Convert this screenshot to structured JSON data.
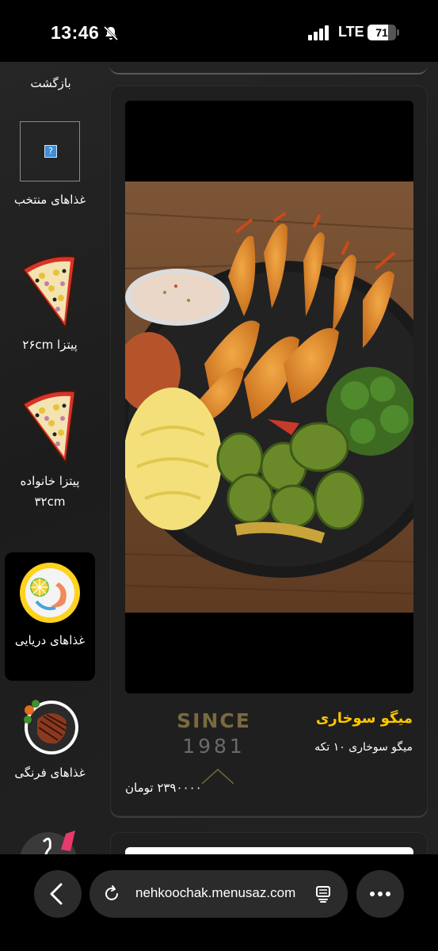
{
  "status_bar": {
    "time": "13:46",
    "network": "LTE",
    "battery": "71",
    "battery_level": 0.71
  },
  "sidebar": {
    "back_label": "بازگشت",
    "items": [
      {
        "label": "غذاهای منتخب",
        "icon": "image-placeholder-icon"
      },
      {
        "label": "پیتزا ۲۶cm",
        "icon": "pizza-slice-icon"
      },
      {
        "label": "پیتزا خانواده ۳۲cm",
        "icon": "pizza-slice-icon"
      },
      {
        "label": "غذاهای دریایی",
        "icon": "seafood-icon",
        "active": true
      },
      {
        "label": "غذاهای فرنگی",
        "icon": "steak-icon"
      },
      {
        "label": "",
        "icon": "drinks-icon"
      }
    ]
  },
  "product": {
    "name": "میگو سوخاری",
    "description": "میگو سوخاری ۱۰ تکه",
    "price": "۲۳۹۰۰۰۰ تومان",
    "badge_since": "SINCE",
    "badge_year": "1981",
    "image": "fried-shrimp-plate-photo"
  },
  "browser": {
    "url": "nehkoochak.menusaz.com"
  },
  "colors": {
    "accent": "#ffc800",
    "background": "#1f1f1f"
  }
}
